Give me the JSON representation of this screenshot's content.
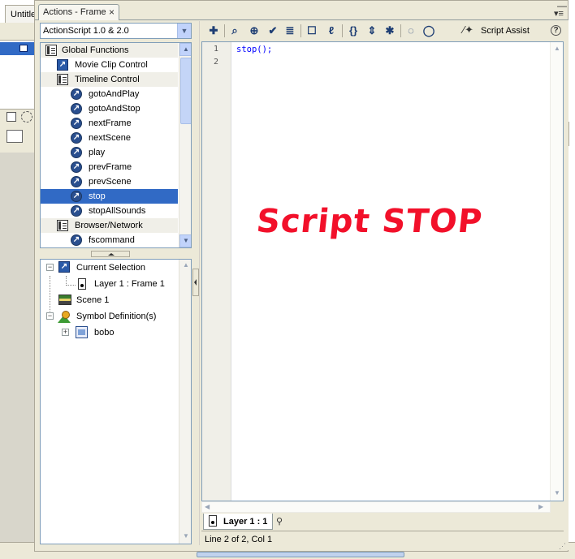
{
  "background_app": {
    "document_tab": "Untitled"
  },
  "panel": {
    "tab_title": "Actions - Frame",
    "close_glyph": "×"
  },
  "toolbox": {
    "version_selected": "ActionScript 1.0 & 2.0",
    "items": [
      {
        "label": "Global Functions",
        "type": "category",
        "icon": "book-icon"
      },
      {
        "label": "Movie Clip Control",
        "type": "clip",
        "icon": "movieclip-icon"
      },
      {
        "label": "Timeline Control",
        "type": "category",
        "icon": "book-icon"
      },
      {
        "label": "gotoAndPlay",
        "type": "function",
        "icon": "function-icon"
      },
      {
        "label": "gotoAndStop",
        "type": "function",
        "icon": "function-icon"
      },
      {
        "label": "nextFrame",
        "type": "function",
        "icon": "function-icon"
      },
      {
        "label": "nextScene",
        "type": "function",
        "icon": "function-icon"
      },
      {
        "label": "play",
        "type": "function",
        "icon": "function-icon"
      },
      {
        "label": "prevFrame",
        "type": "function",
        "icon": "function-icon"
      },
      {
        "label": "prevScene",
        "type": "function",
        "icon": "function-icon"
      },
      {
        "label": "stop",
        "type": "function",
        "icon": "function-icon",
        "selected": true
      },
      {
        "label": "stopAllSounds",
        "type": "function",
        "icon": "function-icon"
      },
      {
        "label": "Browser/Network",
        "type": "category",
        "icon": "book-icon"
      },
      {
        "label": "fscommand",
        "type": "function",
        "icon": "function-icon"
      }
    ]
  },
  "navigator": {
    "current_selection": "Current Selection",
    "frame": "Layer 1 : Frame 1",
    "scene": "Scene 1",
    "symbol_definitions": "Symbol Definition(s)",
    "symbol": "bobo"
  },
  "toolbar": {
    "script_assist": "Script Assist",
    "help": "?"
  },
  "editor": {
    "line_numbers": [
      "1",
      "2"
    ],
    "code_lines": [
      "stop();",
      ""
    ]
  },
  "overlay": {
    "text": "Script STOP",
    "color": "#f2102a"
  },
  "footer": {
    "layer_tab": "Layer 1 : 1",
    "status": "Line 2 of 2, Col 1"
  },
  "colors": {
    "selection": "#316ac5",
    "panel_bg": "#ece9d8"
  }
}
